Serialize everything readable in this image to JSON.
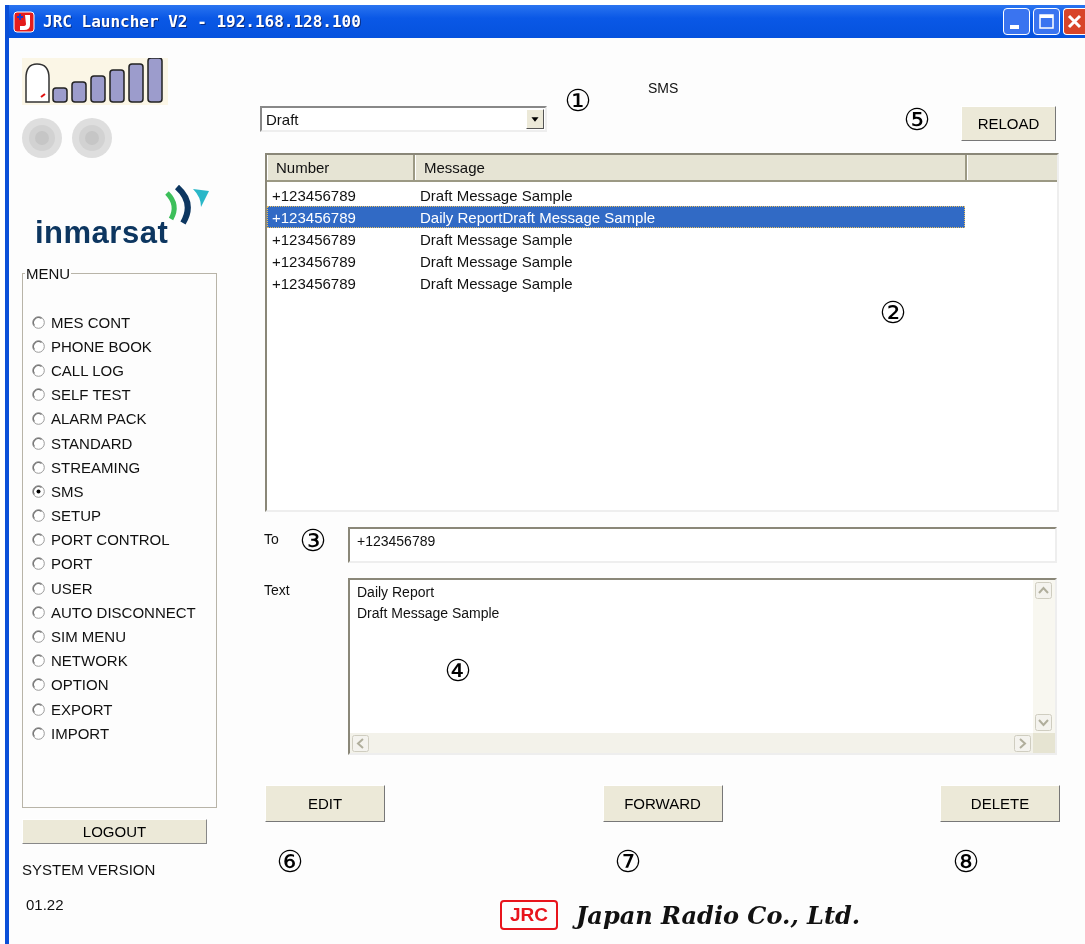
{
  "window": {
    "title": "JRC Launcher V2 - 192.168.128.100"
  },
  "logo": {
    "text": "inmarsat"
  },
  "menu": {
    "title": "MENU",
    "items": [
      {
        "label": "MES CONT",
        "selected": false
      },
      {
        "label": "PHONE BOOK",
        "selected": false
      },
      {
        "label": "CALL LOG",
        "selected": false
      },
      {
        "label": "SELF TEST",
        "selected": false
      },
      {
        "label": "ALARM PACK",
        "selected": false
      },
      {
        "label": "STANDARD",
        "selected": false
      },
      {
        "label": "STREAMING",
        "selected": false
      },
      {
        "label": "SMS",
        "selected": true
      },
      {
        "label": "SETUP",
        "selected": false
      },
      {
        "label": "PORT CONTROL",
        "selected": false
      },
      {
        "label": "PORT",
        "selected": false
      },
      {
        "label": "USER",
        "selected": false
      },
      {
        "label": "AUTO DISCONNECT",
        "selected": false
      },
      {
        "label": "SIM MENU",
        "selected": false
      },
      {
        "label": "NETWORK",
        "selected": false
      },
      {
        "label": "OPTION",
        "selected": false
      },
      {
        "label": "EXPORT",
        "selected": false
      },
      {
        "label": "IMPORT",
        "selected": false
      }
    ]
  },
  "logout_button": "LOGOUT",
  "system_version": {
    "label": "SYSTEM VERSION",
    "value": "01.22"
  },
  "page_title": "SMS",
  "folder_dropdown": {
    "value": "Draft"
  },
  "reload_button": "RELOAD",
  "table": {
    "columns": [
      "Number",
      "Message"
    ],
    "rows": [
      {
        "number": "+123456789",
        "message": "Draft Message Sample",
        "selected": false
      },
      {
        "number": "+123456789",
        "message": "Daily ReportDraft Message Sample",
        "selected": true
      },
      {
        "number": "+123456789",
        "message": "Draft Message Sample",
        "selected": false
      },
      {
        "number": "+123456789",
        "message": "Draft Message Sample",
        "selected": false
      },
      {
        "number": "+123456789",
        "message": "Draft Message Sample",
        "selected": false
      }
    ]
  },
  "to": {
    "label": "To",
    "value": "+123456789"
  },
  "text": {
    "label": "Text",
    "value": "Daily Report\nDraft Message Sample"
  },
  "buttons": [
    "EDIT",
    "FORWARD",
    "DELETE"
  ],
  "callouts": {
    "dropdown": "①",
    "table": "②",
    "to": "③",
    "text": "④",
    "reload": "⑤",
    "edit": "⑥",
    "forward": "⑦",
    "delete": "⑧"
  },
  "footer": {
    "badge": "JRC",
    "company": "Japan Radio Co., Ltd."
  }
}
